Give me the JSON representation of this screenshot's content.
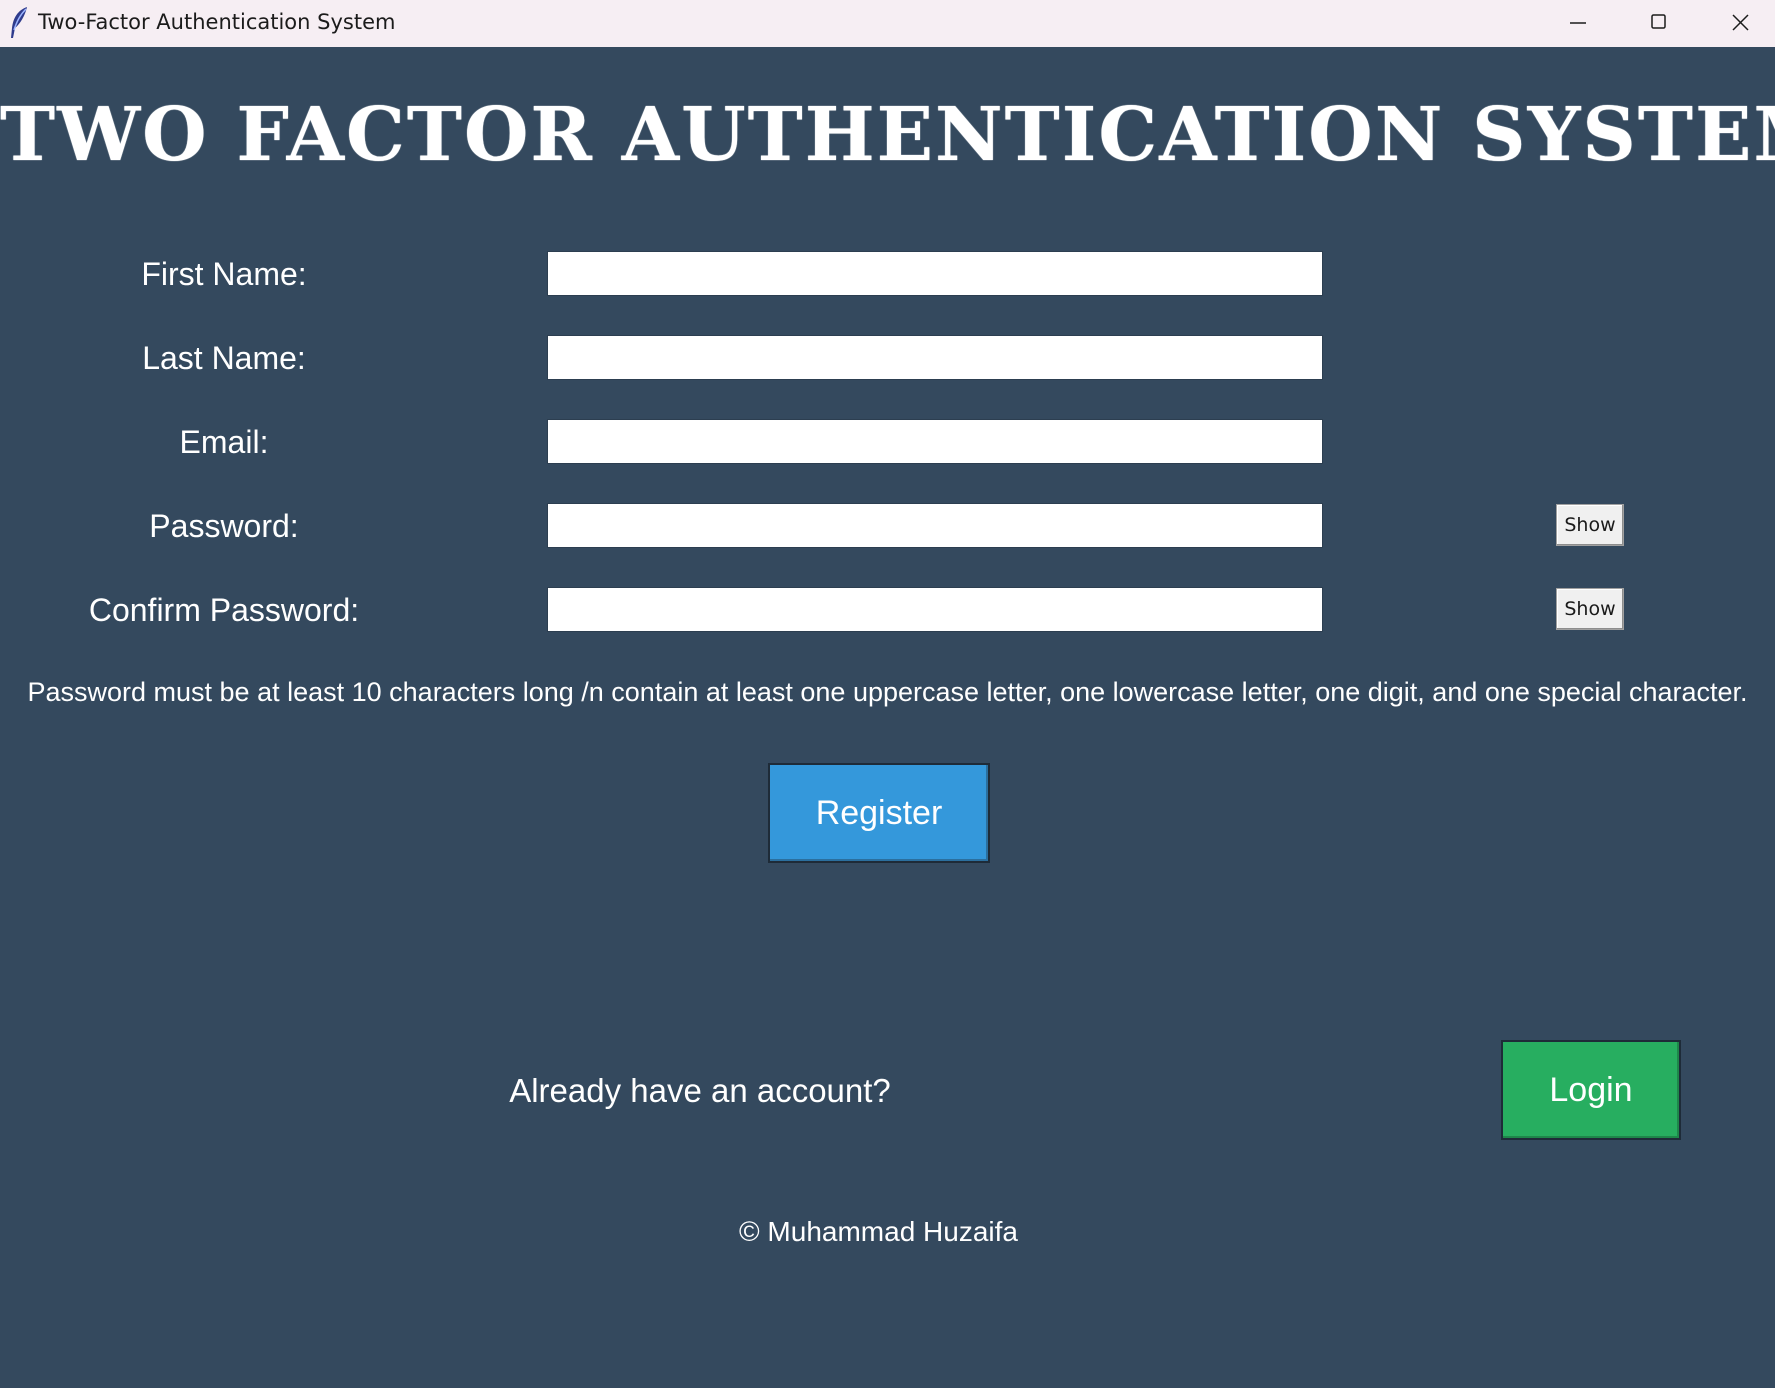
{
  "window": {
    "title": "Two-Factor Authentication System",
    "icon": "feather-icon",
    "controls": [
      "minimize-icon",
      "maximize-icon",
      "close-icon"
    ]
  },
  "heading": "TWO FACTOR AUTHENTICATION SYSTEM",
  "form": {
    "first_name": {
      "label": "First Name:",
      "value": ""
    },
    "last_name": {
      "label": "Last Name:",
      "value": ""
    },
    "email": {
      "label": "Email:",
      "value": ""
    },
    "password": {
      "label": "Password:",
      "value": "",
      "show_label": "Show"
    },
    "confirm_password": {
      "label": "Confirm Password:",
      "value": "",
      "show_label": "Show"
    }
  },
  "hint": "Password must be at least 10 characters long /n contain at least one uppercase letter, one lowercase letter, one digit, and one special character.",
  "register_label": "Register",
  "account_prompt": "Already have an account?",
  "login_label": "Login",
  "footer": "© Muhammad Huzaifa",
  "colors": {
    "background": "#34495e",
    "register": "#3498db",
    "login": "#27ae60",
    "titlebar": "#f6eef3"
  }
}
